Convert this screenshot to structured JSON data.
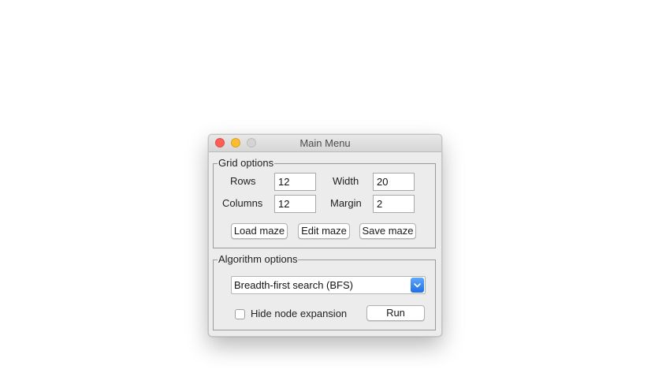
{
  "window": {
    "title": "Main Menu",
    "controls": [
      "close-button",
      "minimize-button",
      "zoom-button"
    ]
  },
  "grid_options": {
    "legend": "Grid options",
    "rows_label": "Rows",
    "rows_value": "12",
    "columns_label": "Columns",
    "columns_value": "12",
    "width_label": "Width",
    "width_value": "20",
    "margin_label": "Margin",
    "margin_value": "2",
    "load_maze_label": "Load maze",
    "edit_maze_label": "Edit maze",
    "save_maze_label": "Save maze"
  },
  "algorithm_options": {
    "legend": "Algorithm options",
    "selected_algorithm": "Breadth-first search (BFS)",
    "hide_node_expansion_label": "Hide node expansion",
    "hide_node_expansion_checked": false,
    "run_label": "Run"
  },
  "colors": {
    "close": "#fd5f57",
    "minimize": "#febd2e",
    "zoom_disabled": "#d4d4d4",
    "select_accent": "#2f80ed",
    "window_background": "#ececec"
  }
}
